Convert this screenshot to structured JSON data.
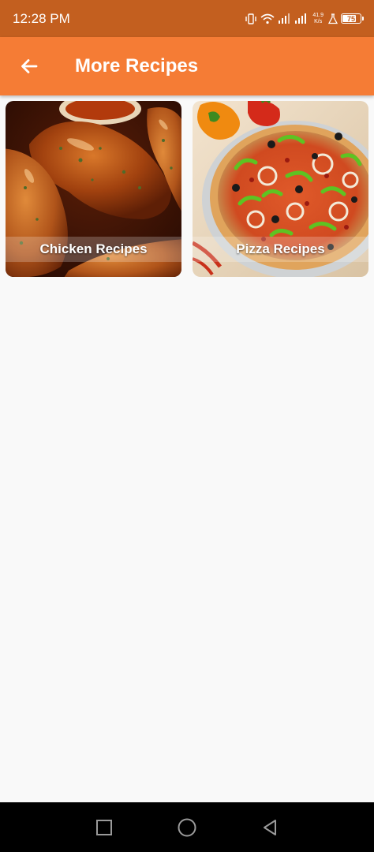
{
  "status_bar": {
    "time": "12:28 PM",
    "net_speed_value": "41.9",
    "net_speed_unit": "K/s",
    "battery_level": "75",
    "icons": [
      "vibrate-icon",
      "wifi-icon",
      "signal-icon",
      "signal-icon",
      "flask-icon",
      "battery-icon"
    ]
  },
  "app_bar": {
    "title": "More Recipes",
    "back_icon": "arrow-left-icon"
  },
  "recipes": [
    {
      "label": "Chicken Recipes",
      "image": "grilled-chicken"
    },
    {
      "label": "Pizza Recipes",
      "image": "veggie-pizza"
    }
  ],
  "nav_bar": {
    "buttons": [
      "recent-apps-icon",
      "home-icon",
      "back-triangle-icon"
    ]
  },
  "colors": {
    "status_bar": "#c35f1f",
    "app_bar": "#f57c35",
    "background": "#f9f9f9"
  }
}
